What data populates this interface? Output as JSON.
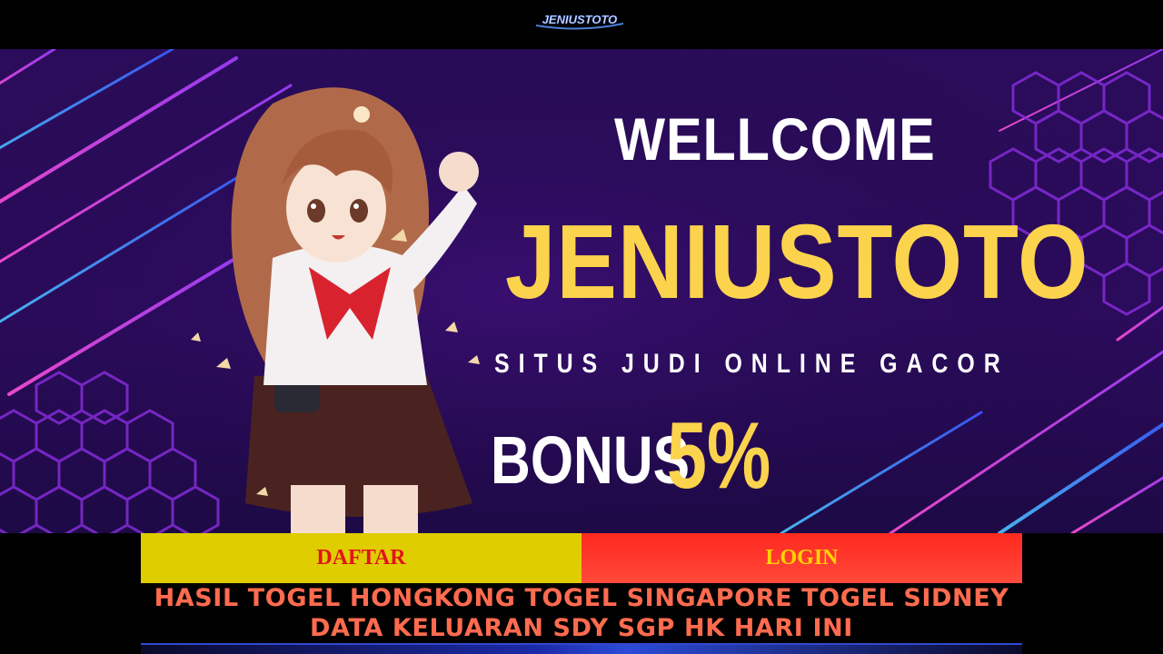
{
  "header": {
    "logo_text": "JENIUSTOTO"
  },
  "banner": {
    "welcome": "WELLCOME",
    "brand": "JENIUSTOTO",
    "tagline": "SITUS JUDI ONLINE GACOR",
    "bonus_label": "BONUS",
    "bonus_value": "5%"
  },
  "actions": {
    "daftar_label": "DAFTAR",
    "login_label": "LOGIN"
  },
  "headline": {
    "line1": "HASIL TOGEL HONGKONG TOGEL SINGAPORE TOGEL SIDNEY",
    "line2": "DATA KELUARAN SDY SGP HK HARI INI"
  },
  "colors": {
    "daftar_bg": "#e0cd00",
    "daftar_text": "#e0151a",
    "login_bg": "#ff2a1e",
    "login_text": "#ffd400",
    "headline": "#ff6b4f",
    "brand_yellow": "#fcd34d"
  }
}
